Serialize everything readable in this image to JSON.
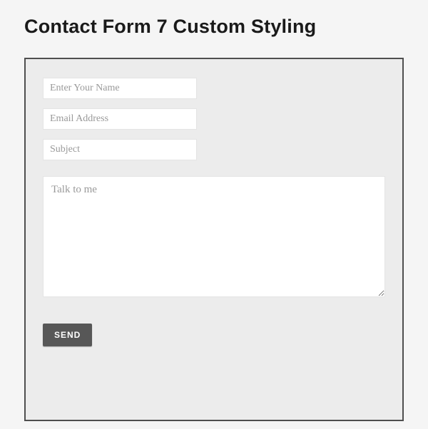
{
  "header": {
    "title": "Contact Form 7 Custom Styling"
  },
  "form": {
    "name": {
      "placeholder": "Enter Your Name",
      "value": ""
    },
    "email": {
      "placeholder": "Email Address",
      "value": ""
    },
    "subject": {
      "placeholder": "Subject",
      "value": ""
    },
    "message": {
      "placeholder": "Talk to me",
      "value": ""
    },
    "submit_label": "SEND"
  }
}
